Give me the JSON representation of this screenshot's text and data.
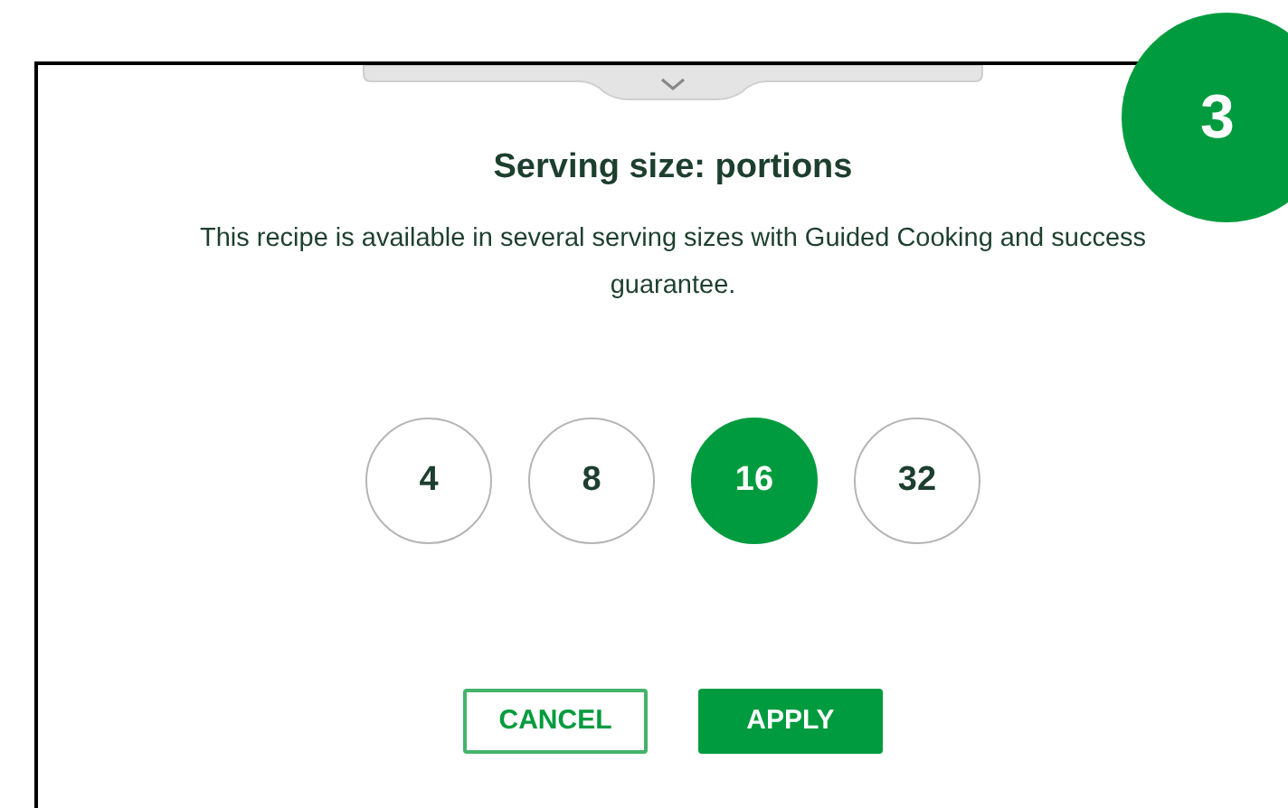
{
  "step_badge": "3",
  "dialog": {
    "title": "Serving size: portions",
    "description": "This recipe is available in several serving sizes with Guided Cooking and success guarantee.",
    "portions": [
      {
        "label": "4",
        "selected": false
      },
      {
        "label": "8",
        "selected": false
      },
      {
        "label": "16",
        "selected": true
      },
      {
        "label": "32",
        "selected": false
      }
    ],
    "buttons": [
      {
        "label": "CANCEL",
        "kind": "outline"
      },
      {
        "label": "APPLY",
        "kind": "primary"
      }
    ]
  }
}
